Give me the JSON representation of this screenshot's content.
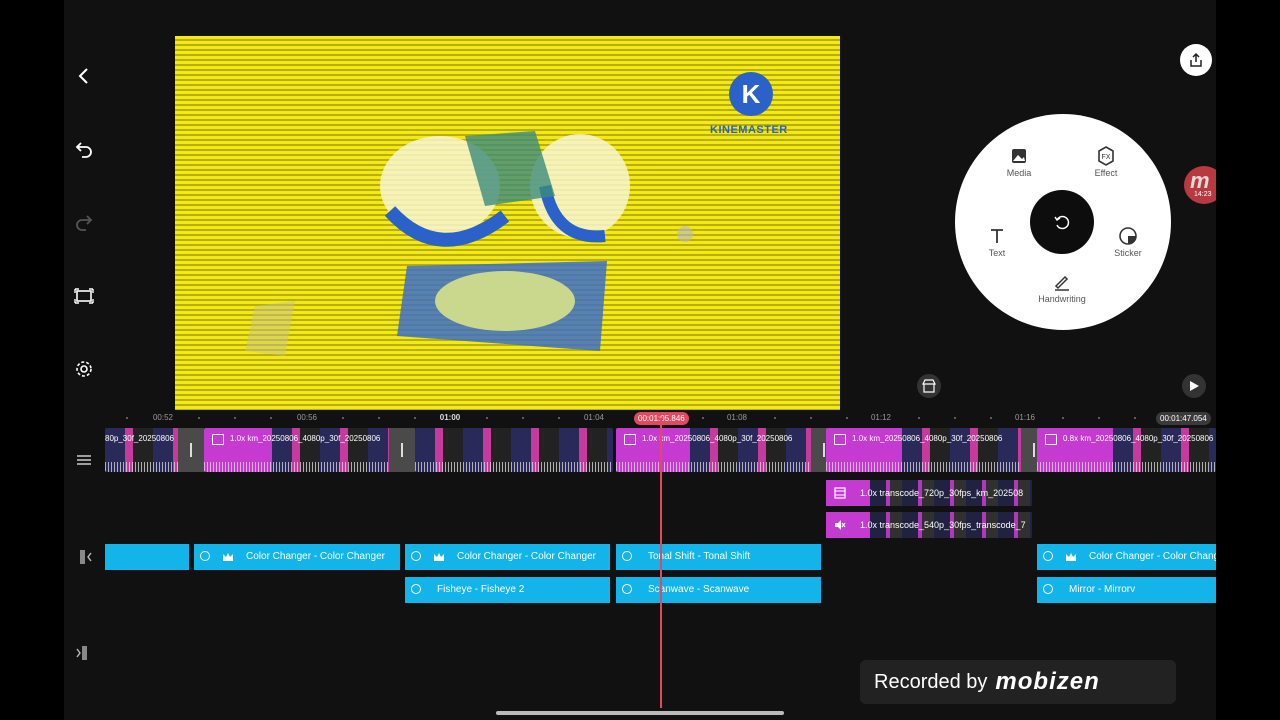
{
  "watermark": {
    "logo_letter": "K",
    "brand": "KINEMASTER"
  },
  "radial_menu": {
    "media": "Media",
    "effect": "Effect",
    "text": "Text",
    "sticker": "Sticker",
    "handwriting": "Handwriting"
  },
  "floating_badge": {
    "letter": "m",
    "time": "14:23"
  },
  "ruler": {
    "labels": [
      "00:52",
      "00:56",
      "01:00",
      "01:04",
      "01:08",
      "01:12",
      "01:16"
    ],
    "playhead_time": "00:01:05.846",
    "end_time": "00:01:47.054"
  },
  "clips": [
    {
      "label": "80p_30f_20250806"
    },
    {
      "label": "1.0x km_20250806_4080p_30f_20250806"
    },
    {
      "label": ""
    },
    {
      "label": "1.0x km_20250806_4080p_30f_20250806"
    },
    {
      "label": "1.0x km_20250806_4080p_30f_20250806"
    },
    {
      "label": "0.8x km_20250806_4080p_30f_20250806"
    }
  ],
  "layers": [
    {
      "label": "1.0x transcode_720p_30fps_km_202508"
    },
    {
      "label": "1.0x transcode_540p_30fps_transcode_7"
    }
  ],
  "effects_row1": [
    {
      "label": ""
    },
    {
      "label": "Color Changer - Color Changer"
    },
    {
      "label": "Color Changer - Color Changer"
    },
    {
      "label": "Tonal Shift - Tonal Shift"
    },
    {
      "label": "Color Changer - Color Changer"
    }
  ],
  "effects_row2": [
    {
      "label": "Fisheye - Fisheye 2"
    },
    {
      "label": "Scanwave - Scanwave"
    },
    {
      "label": "Mirror - Mirrorv"
    }
  ],
  "recorded_by": {
    "prefix": "Recorded by",
    "brand": "mobizen"
  },
  "colors": {
    "accent_red": "#e2495e",
    "clip_magenta": "#c53ad0",
    "effect_blue": "#12b4ea"
  }
}
